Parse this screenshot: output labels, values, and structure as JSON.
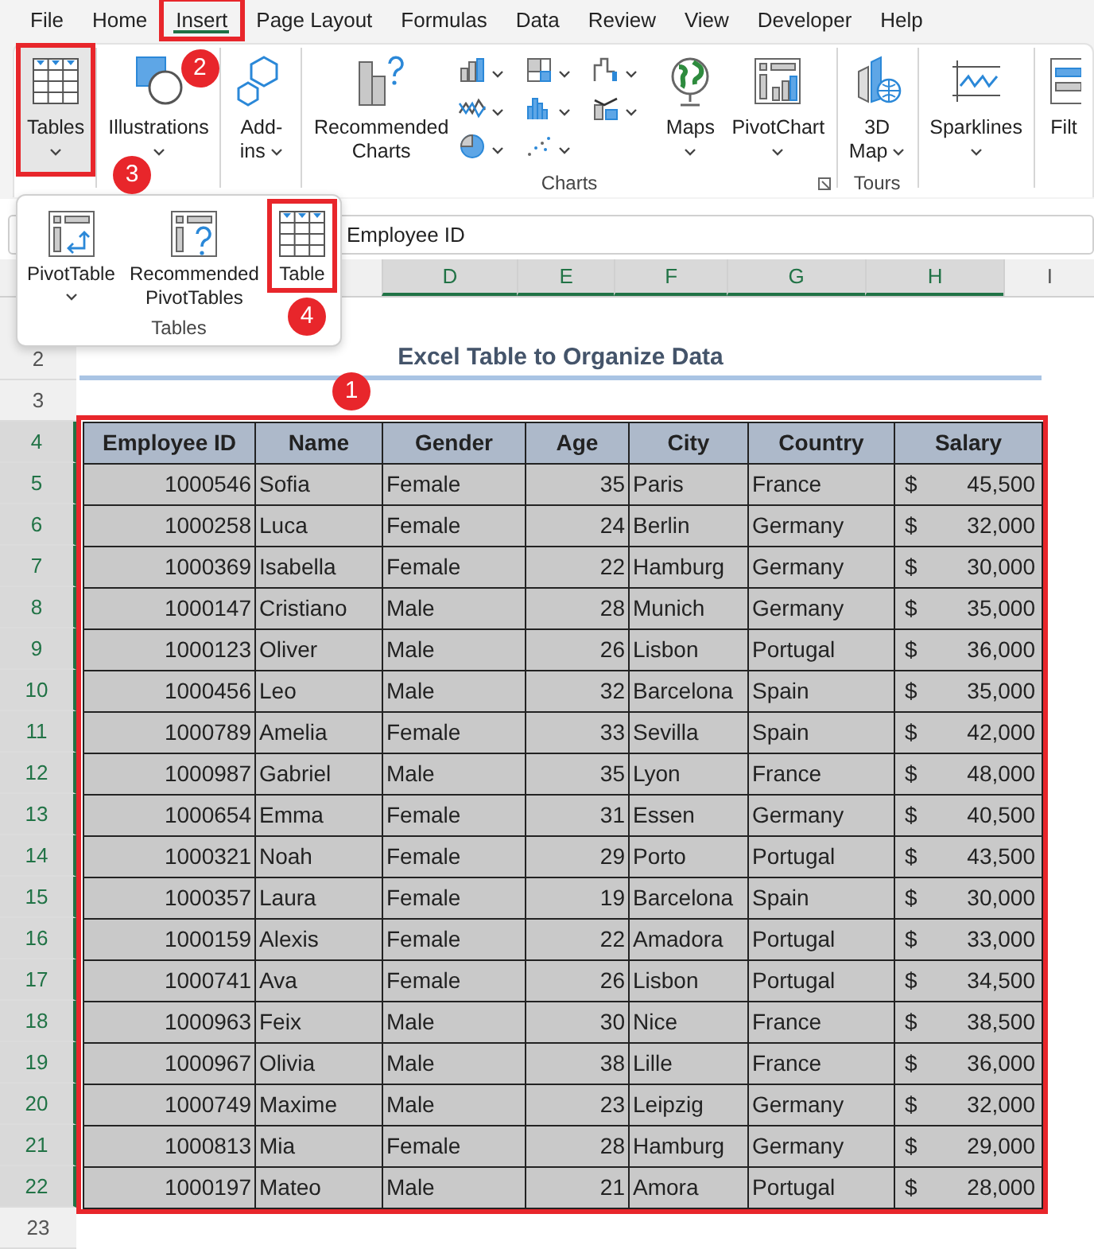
{
  "menu_tabs": [
    {
      "label": "File",
      "selected": false,
      "highlighted": false
    },
    {
      "label": "Home",
      "selected": false,
      "highlighted": false
    },
    {
      "label": "Insert",
      "selected": true,
      "highlighted": true,
      "badge": "2"
    },
    {
      "label": "Page Layout",
      "selected": false,
      "highlighted": false
    },
    {
      "label": "Formulas",
      "selected": false,
      "highlighted": false
    },
    {
      "label": "Data",
      "selected": false,
      "highlighted": false
    },
    {
      "label": "Review",
      "selected": false,
      "highlighted": false
    },
    {
      "label": "View",
      "selected": false,
      "highlighted": false
    },
    {
      "label": "Developer",
      "selected": false,
      "highlighted": false
    },
    {
      "label": "Help",
      "selected": false,
      "highlighted": false
    }
  ],
  "ribbon": {
    "groups": [
      {
        "items": [
          {
            "kind": "large",
            "label": "Tables",
            "caret": true,
            "pressed": true,
            "highlighted": true,
            "badge": "3"
          }
        ]
      },
      {
        "items": [
          {
            "kind": "large",
            "label": "Illustrations",
            "caret": true,
            "pressed": false,
            "highlighted": false
          }
        ]
      },
      {
        "items": [
          {
            "kind": "stacked",
            "label": "Add-ins",
            "caret": true,
            "pressed": false,
            "highlighted": false
          }
        ]
      },
      {
        "label": "Charts",
        "launcher": true,
        "items": [
          {
            "kind": "large",
            "label": "Recommended Charts",
            "caret": false,
            "pressed": false,
            "highlighted": false
          },
          {
            "kind": "chart-gallery"
          },
          {
            "kind": "large",
            "label": "Maps",
            "caret": true,
            "pressed": false,
            "highlighted": false
          },
          {
            "kind": "large",
            "label": "PivotChart",
            "caret": true,
            "pressed": false,
            "highlighted": false
          }
        ]
      },
      {
        "label": "Tours",
        "items": [
          {
            "kind": "stacked",
            "label": "3D Map",
            "caret": true,
            "pressed": false,
            "highlighted": false
          }
        ]
      },
      {
        "items": [
          {
            "kind": "large",
            "label": "Sparklines",
            "caret": true,
            "pressed": false,
            "highlighted": false
          }
        ]
      },
      {
        "items": [
          {
            "kind": "large",
            "label": "Filt",
            "caret": false,
            "pressed": false,
            "highlighted": false
          }
        ]
      }
    ]
  },
  "tables_menu": {
    "label": "Tables",
    "items": [
      {
        "label": "PivotTable",
        "caret": true,
        "highlighted": false
      },
      {
        "label": "Recommended PivotTables",
        "caret": false,
        "highlighted": false
      },
      {
        "label": "Table",
        "caret": false,
        "highlighted": true,
        "badge": "4"
      }
    ]
  },
  "formula_bar": {
    "value": "Employee ID"
  },
  "column_headers": [
    {
      "label": "D",
      "selected": true
    },
    {
      "label": "E",
      "selected": true
    },
    {
      "label": "F",
      "selected": true
    },
    {
      "label": "G",
      "selected": true
    },
    {
      "label": "H",
      "selected": true
    },
    {
      "label": "I",
      "selected": false
    }
  ],
  "row_headers": [
    {
      "label": "2",
      "selected": false
    },
    {
      "label": "3",
      "selected": false
    },
    {
      "label": "4",
      "selected": true
    },
    {
      "label": "5",
      "selected": true
    },
    {
      "label": "6",
      "selected": true
    },
    {
      "label": "7",
      "selected": true
    },
    {
      "label": "8",
      "selected": true
    },
    {
      "label": "9",
      "selected": true
    },
    {
      "label": "10",
      "selected": true
    },
    {
      "label": "11",
      "selected": true
    },
    {
      "label": "12",
      "selected": true
    },
    {
      "label": "13",
      "selected": true
    },
    {
      "label": "14",
      "selected": true
    },
    {
      "label": "15",
      "selected": true
    },
    {
      "label": "16",
      "selected": true
    },
    {
      "label": "17",
      "selected": true
    },
    {
      "label": "18",
      "selected": true
    },
    {
      "label": "19",
      "selected": true
    },
    {
      "label": "20",
      "selected": true
    },
    {
      "label": "21",
      "selected": true
    },
    {
      "label": "22",
      "selected": true
    },
    {
      "label": "23",
      "selected": false
    }
  ],
  "title": "Excel Table to Organize Data",
  "table": {
    "highlighted": true,
    "badge": "1",
    "columns": [
      "Employee ID",
      "Name",
      "Gender",
      "Age",
      "City",
      "Country",
      "Salary"
    ],
    "rows": [
      [
        "1000546",
        "Sofia",
        "Female",
        "35",
        "Paris",
        "France",
        {
          "symbol": "$",
          "amount": "45,500"
        }
      ],
      [
        "1000258",
        "Luca",
        "Female",
        "24",
        "Berlin",
        "Germany",
        {
          "symbol": "$",
          "amount": "32,000"
        }
      ],
      [
        "1000369",
        "Isabella",
        "Female",
        "22",
        "Hamburg",
        "Germany",
        {
          "symbol": "$",
          "amount": "30,000"
        }
      ],
      [
        "1000147",
        "Cristiano",
        "Male",
        "28",
        "Munich",
        "Germany",
        {
          "symbol": "$",
          "amount": "35,000"
        }
      ],
      [
        "1000123",
        "Oliver",
        "Male",
        "26",
        "Lisbon",
        "Portugal",
        {
          "symbol": "$",
          "amount": "36,000"
        }
      ],
      [
        "1000456",
        "Leo",
        "Male",
        "32",
        "Barcelona",
        "Spain",
        {
          "symbol": "$",
          "amount": "35,000"
        }
      ],
      [
        "1000789",
        "Amelia",
        "Female",
        "33",
        "Sevilla",
        "Spain",
        {
          "symbol": "$",
          "amount": "42,000"
        }
      ],
      [
        "1000987",
        "Gabriel",
        "Male",
        "35",
        "Lyon",
        "France",
        {
          "symbol": "$",
          "amount": "48,000"
        }
      ],
      [
        "1000654",
        "Emma",
        "Female",
        "31",
        "Essen",
        "Germany",
        {
          "symbol": "$",
          "amount": "40,500"
        }
      ],
      [
        "1000321",
        "Noah",
        "Female",
        "29",
        "Porto",
        "Portugal",
        {
          "symbol": "$",
          "amount": "43,500"
        }
      ],
      [
        "1000357",
        "Laura",
        "Female",
        "19",
        "Barcelona",
        "Spain",
        {
          "symbol": "$",
          "amount": "30,000"
        }
      ],
      [
        "1000159",
        "Alexis",
        "Female",
        "22",
        "Amadora",
        "Portugal",
        {
          "symbol": "$",
          "amount": "33,000"
        }
      ],
      [
        "1000741",
        "Ava",
        "Female",
        "26",
        "Lisbon",
        "Portugal",
        {
          "symbol": "$",
          "amount": "34,500"
        }
      ],
      [
        "1000963",
        "Feix",
        "Male",
        "30",
        "Nice",
        "France",
        {
          "symbol": "$",
          "amount": "38,500"
        }
      ],
      [
        "1000967",
        "Olivia",
        "Male",
        "38",
        "Lille",
        "France",
        {
          "symbol": "$",
          "amount": "36,000"
        }
      ],
      [
        "1000749",
        "Maxime",
        "Male",
        "23",
        "Leipzig",
        "Germany",
        {
          "symbol": "$",
          "amount": "32,000"
        }
      ],
      [
        "1000813",
        "Mia",
        "Female",
        "28",
        "Hamburg",
        "Germany",
        {
          "symbol": "$",
          "amount": "29,000"
        }
      ],
      [
        "1000197",
        "Mateo",
        "Male",
        "21",
        "Amora",
        "Portugal",
        {
          "symbol": "$",
          "amount": "28,000"
        }
      ]
    ]
  }
}
